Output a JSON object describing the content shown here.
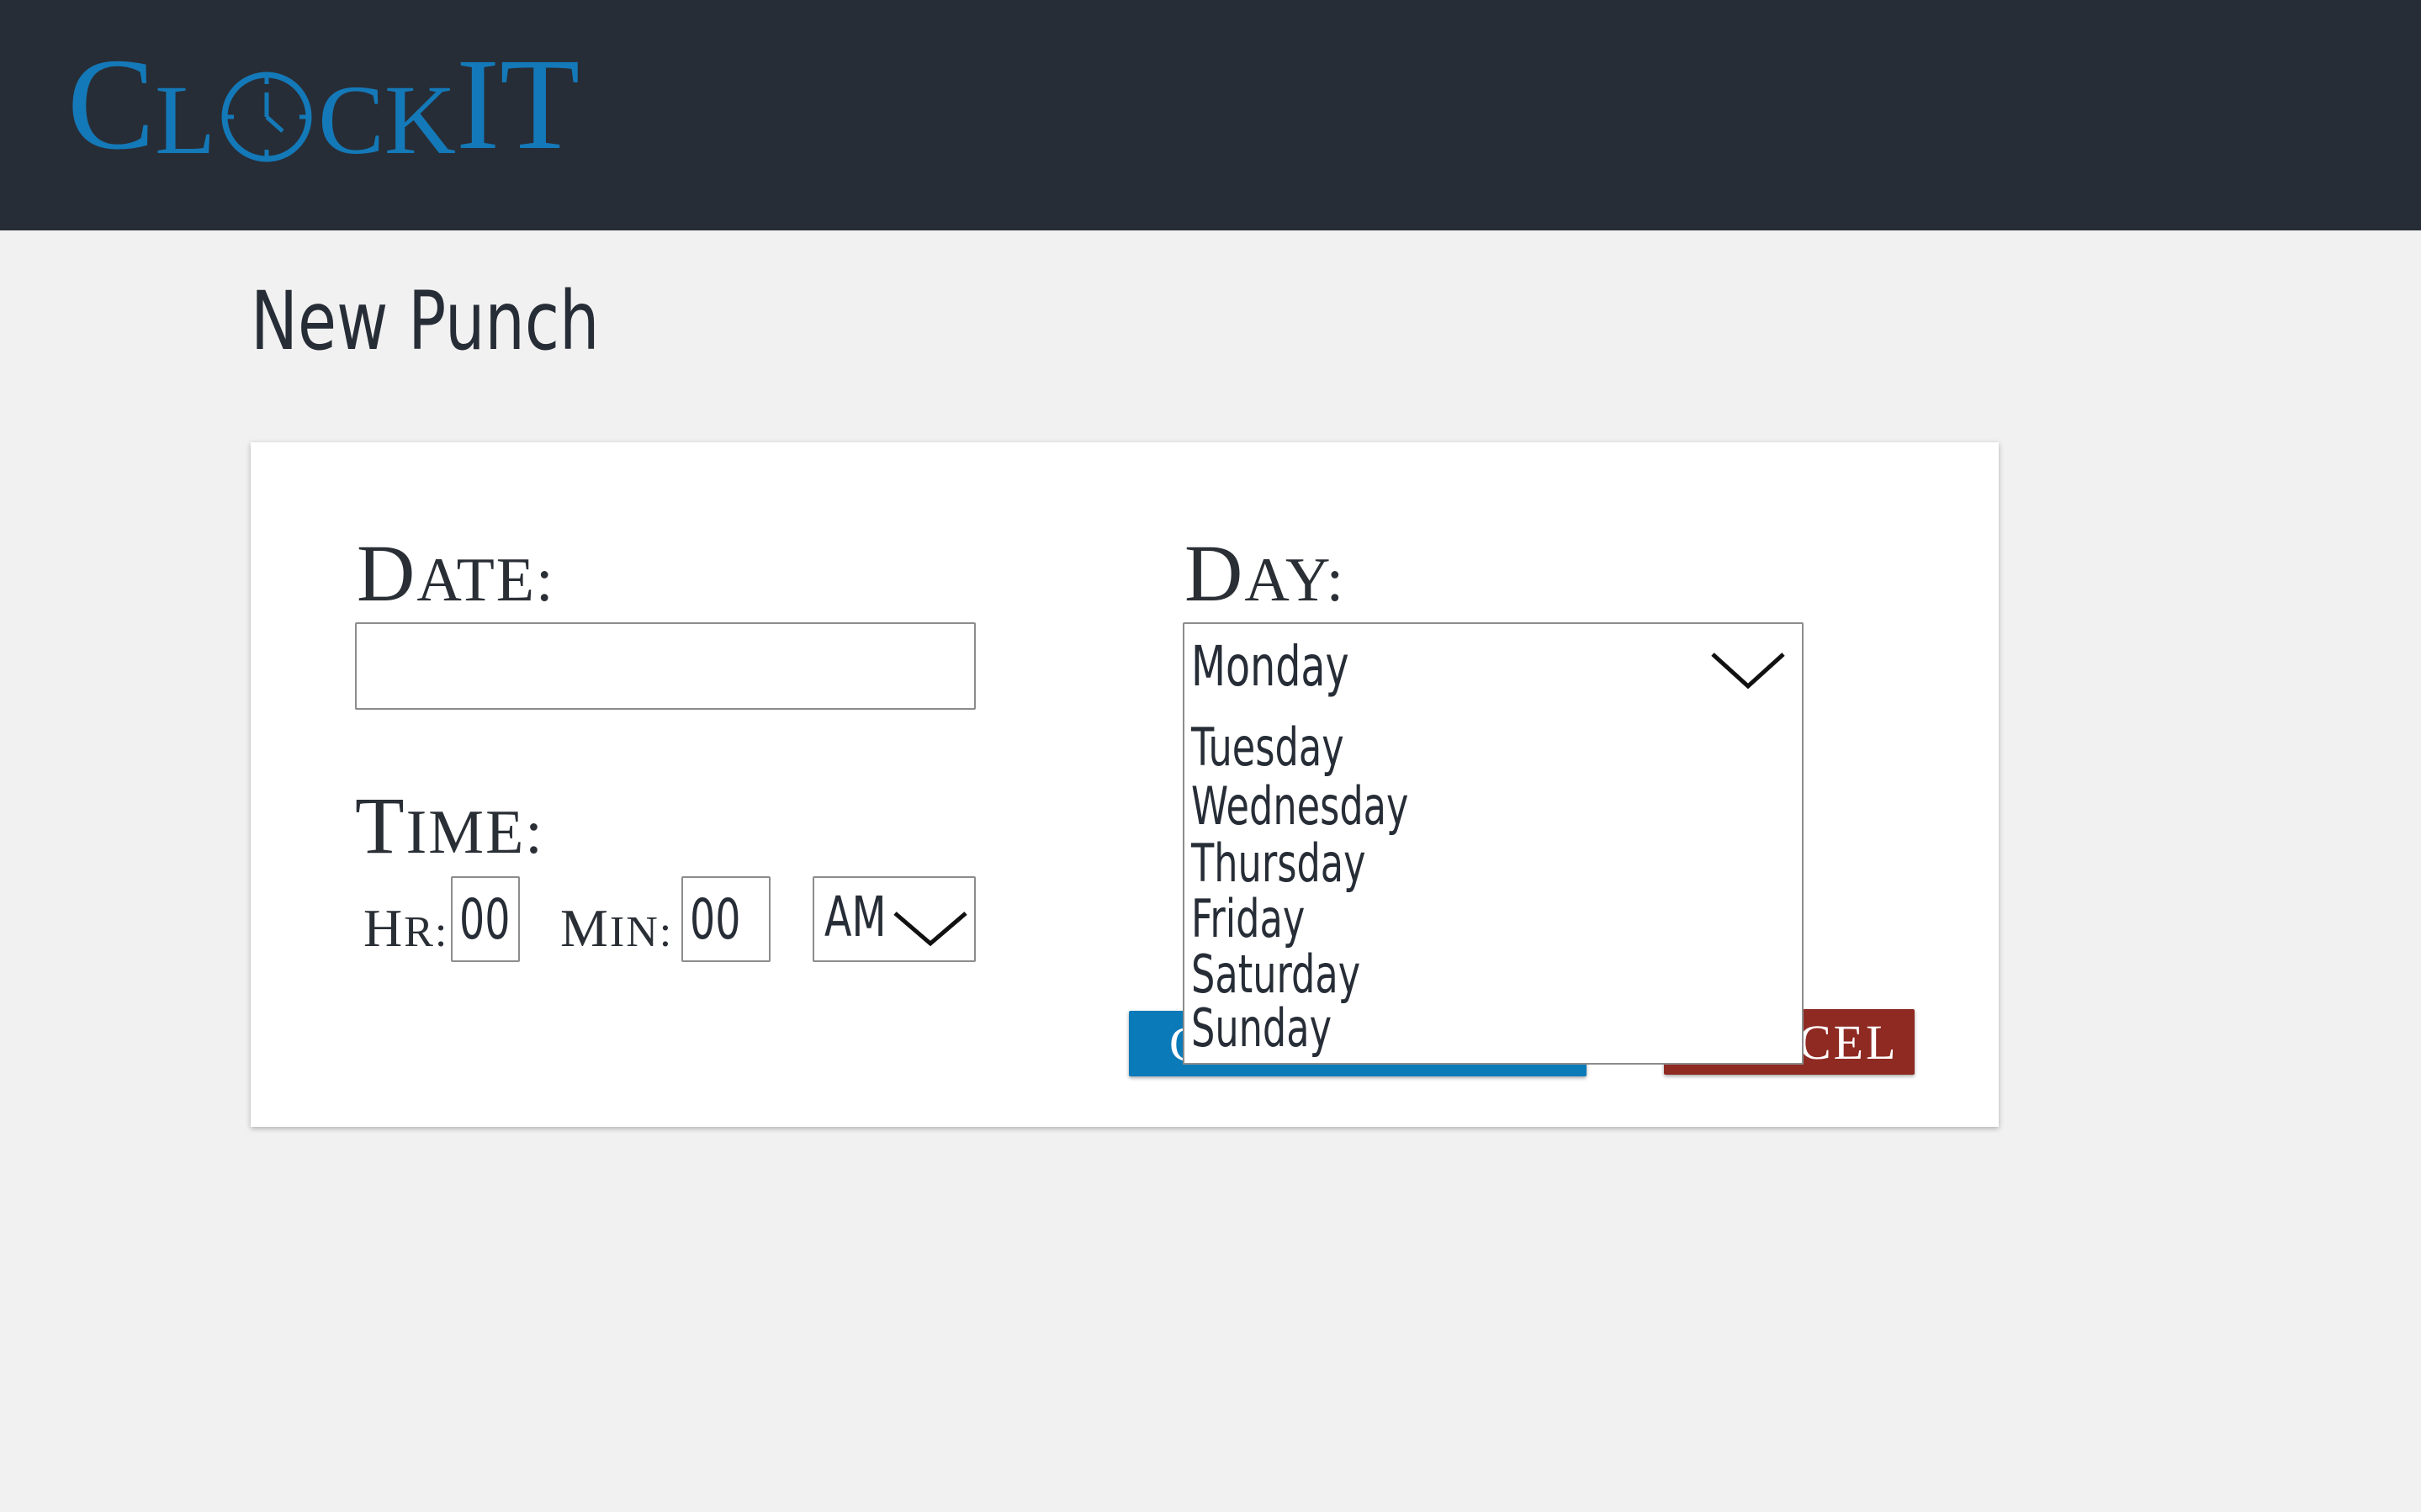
{
  "header": {
    "logo": {
      "c1": "C",
      "l": "L",
      "clock_icon": "clock-icon",
      "rest_small": "CK",
      "it": "IT",
      "color": "#1479b8"
    },
    "background": "#272d36"
  },
  "page": {
    "title": "New Punch"
  },
  "form": {
    "date": {
      "label_cap": "D",
      "label_rest": "ATE:",
      "value": ""
    },
    "day": {
      "label_cap": "D",
      "label_rest": "AY:",
      "selected": "Monday",
      "options": [
        "Tuesday",
        "Wednesday",
        "Thursday",
        "Friday",
        "Saturday",
        "Sunday"
      ]
    },
    "time": {
      "label_cap": "T",
      "label_rest": "IME:",
      "hr_label_cap": "H",
      "hr_label_rest": "R:",
      "hr_value": "00",
      "min_label_cap": "M",
      "min_label_rest": "IN:",
      "min_value": "00",
      "ampm_selected": "AM"
    },
    "buttons": {
      "create_label_visible": "C",
      "cancel_label_visible": "CEL",
      "create_color": "#0b7ab8",
      "cancel_color": "#8f2a23"
    }
  }
}
